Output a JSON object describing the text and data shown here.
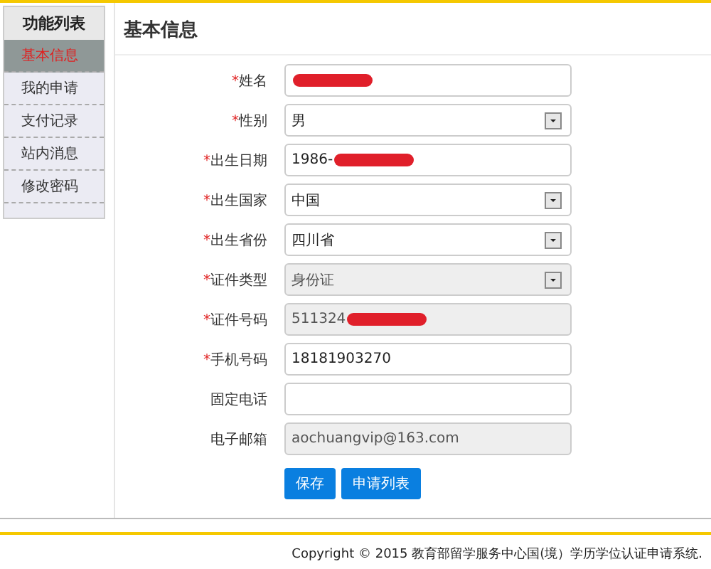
{
  "sidebar": {
    "title": "功能列表",
    "items": [
      {
        "label": "基本信息",
        "selected": true
      },
      {
        "label": "我的申请",
        "selected": false
      },
      {
        "label": "支付记录",
        "selected": false
      },
      {
        "label": "站内消息",
        "selected": false
      },
      {
        "label": "修改密码",
        "selected": false
      }
    ]
  },
  "page_title": "基本信息",
  "fields": [
    {
      "marker": "*",
      "label": "姓名",
      "kind": "text",
      "redacted": true,
      "disabled": false
    },
    {
      "marker": "*",
      "label": "性别",
      "kind": "select",
      "value": "男",
      "redacted": false,
      "disabled": false
    },
    {
      "marker": "*",
      "label": "出生日期",
      "kind": "text",
      "value": "1986-",
      "redacted": true,
      "disabled": false
    },
    {
      "marker": "*",
      "label": "出生国家",
      "kind": "select",
      "value": "中国",
      "redacted": false,
      "disabled": false
    },
    {
      "marker": "*",
      "label": "出生省份",
      "kind": "select",
      "value": "四川省",
      "redacted": false,
      "disabled": false
    },
    {
      "marker": "*",
      "label": "证件类型",
      "kind": "select",
      "value": "身份证",
      "redacted": false,
      "disabled": true
    },
    {
      "marker": "*",
      "label": "证件号码",
      "kind": "text",
      "value": "511324",
      "redacted": true,
      "disabled": true
    },
    {
      "marker": "*",
      "label": "手机号码",
      "kind": "text",
      "value": "18181903270",
      "redacted": false,
      "disabled": false
    },
    {
      "label": "固定电话",
      "kind": "text",
      "redacted": false,
      "disabled": false
    },
    {
      "label": "电子邮箱",
      "kind": "text",
      "value": "aochuangvip@163.com",
      "redacted": false,
      "disabled": true
    }
  ],
  "buttons": [
    "保存",
    "申请列表"
  ],
  "footer": "Copyright © 2015 教育部留学服务中心国(境）学历学位认证申请系统."
}
